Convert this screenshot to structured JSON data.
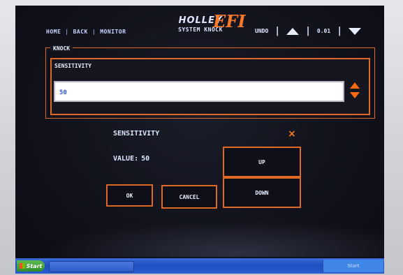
{
  "header": {
    "nav": [
      "HOME",
      "BACK",
      "MONITOR"
    ],
    "brand_main": "HOLLEY",
    "brand_efi": "EFI",
    "brand_sub": "SYSTEM KNOCK",
    "undo_label": "UNDO",
    "step_value": "0.01"
  },
  "panel": {
    "group_label": "KNOCK",
    "field_label": "SENSITIVITY",
    "field_value": "50"
  },
  "dialog": {
    "title": "SENSITIVITY",
    "value_label": "VALUE:",
    "value": "50",
    "up_label": "UP",
    "down_label": "DOWN",
    "ok_label": "OK",
    "cancel_label": "CANCEL",
    "close_glyph": "×"
  },
  "taskbar": {
    "start_label": "Start",
    "tray_text": "Start"
  },
  "colors": {
    "accent": "#e06a24",
    "screen_bg": "#11121b",
    "text": "#e9eeff",
    "value_text": "#2a58d6"
  }
}
